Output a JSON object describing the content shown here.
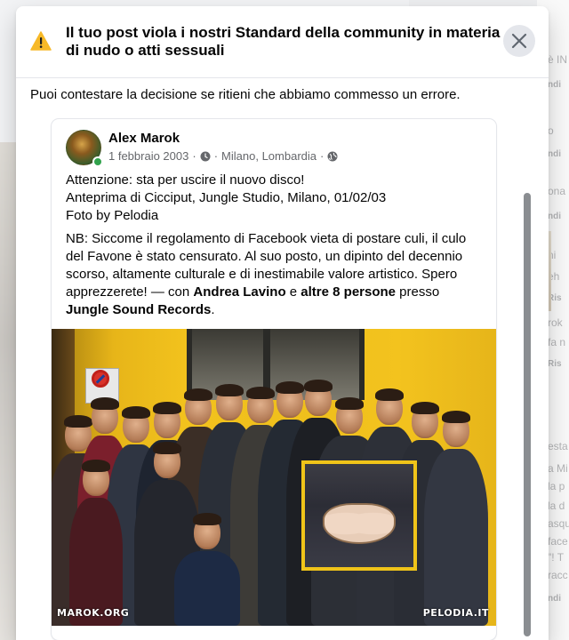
{
  "background": {
    "right_rows": [
      "è IN",
      "ndi",
      "o",
      "ndi",
      "ona",
      "ndi",
      "ni",
      "eh",
      "Ris",
      "rok",
      "fa n",
      "Ris",
      "esta",
      "a Mi",
      "la p",
      "la d",
      "asqu",
      "face",
      "\"! T",
      "racc",
      "ndi"
    ]
  },
  "dialog": {
    "title": "Il tuo post viola i nostri Standard della community in materia di nudo o atti sessuali",
    "warning_icon": "warning-triangle-icon",
    "close_icon": "close-icon",
    "intro": "Puoi contestare la decisione se ritieni che abbiamo commesso un errore."
  },
  "post": {
    "author": "Alex Marok",
    "date": "1 febbraio 2003",
    "separator": "·",
    "location": "Milano, Lombardia",
    "lines_1": [
      "Attenzione: sta per uscire il nuovo disco!",
      "Anteprima di Cicciput, Jungle Studio, Milano, 01/02/03",
      "Foto by Pelodia"
    ],
    "body_text": "NB: Siccome il regolamento di Facebook vieta di postare culi, il culo del Favone è stato censurato. Al suo posto, un dipinto del decennio scorso, altamente culturale e di inestimabile valore artistico. Spero apprezzerete! — con ",
    "tag_1": "Andrea Lavino",
    "conj": " e ",
    "tag_2": "altre 8 persone",
    "presso": " presso ",
    "place": "Jungle Sound Records",
    "period": ".",
    "photo": {
      "watermark_left": "MAROK.ORG",
      "watermark_right": "PELODIA.IT"
    }
  },
  "colors": {
    "online": "#31a24c",
    "warning": "#f7b928",
    "highlight": "#f0c419"
  }
}
